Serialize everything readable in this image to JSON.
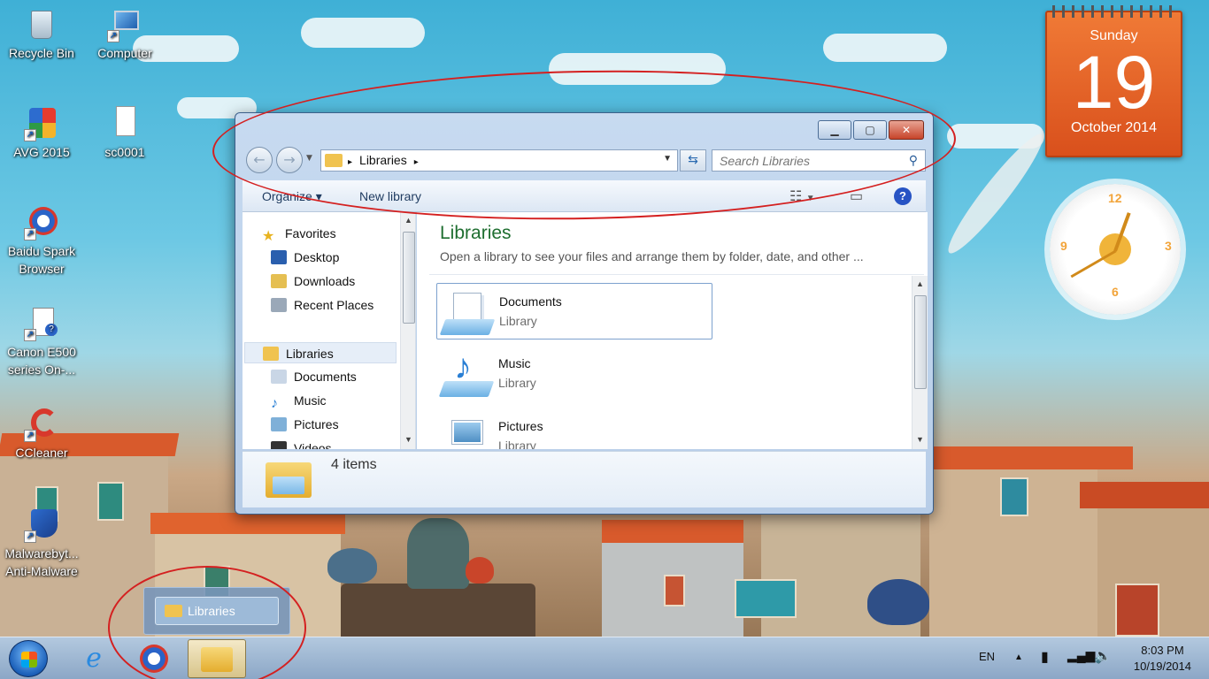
{
  "desktop": {
    "icons": [
      {
        "label": "Recycle Bin"
      },
      {
        "label": "Computer"
      },
      {
        "label": "AVG 2015"
      },
      {
        "label": "sc0001"
      },
      {
        "label": "Baidu Spark Browser"
      },
      {
        "label": "Canon E500 series On-..."
      },
      {
        "label": "CCleaner"
      },
      {
        "label": "Malwarebyt... Anti-Malware"
      }
    ]
  },
  "gadgets": {
    "calendar": {
      "weekday": "Sunday",
      "day": "19",
      "month_year": "October 2014"
    },
    "clock": {
      "n12": "12",
      "n3": "3",
      "n6": "6",
      "n9": "9"
    }
  },
  "window": {
    "controls": {
      "minimize": "▁",
      "maximize": "▢",
      "close": "✕"
    },
    "address": {
      "crumb": "Libraries",
      "sep": "▸"
    },
    "search": {
      "placeholder": "Search Libraries"
    },
    "toolbar": {
      "organize": "Organize ▾",
      "new_library": "New library"
    },
    "nav": {
      "favorites": "Favorites",
      "desktop": "Desktop",
      "downloads": "Downloads",
      "recent": "Recent Places",
      "libraries": "Libraries",
      "documents": "Documents",
      "music": "Music",
      "pictures": "Pictures",
      "videos": "Videos"
    },
    "content": {
      "title": "Libraries",
      "subtitle": "Open a library to see your files and arrange them by folder, date, and other ...",
      "items": [
        {
          "name": "Documents",
          "type": "Library"
        },
        {
          "name": "Music",
          "type": "Library"
        },
        {
          "name": "Pictures",
          "type": "Library"
        }
      ]
    },
    "status": {
      "count": "4 items"
    }
  },
  "taskbar": {
    "preview_label": "Libraries",
    "lang": "EN",
    "time": "8:03 PM",
    "date": "10/19/2014"
  },
  "colors": {
    "accent_green": "#1e6e30",
    "annotation_red": "#d42020",
    "calendar_orange": "#e8632a"
  }
}
